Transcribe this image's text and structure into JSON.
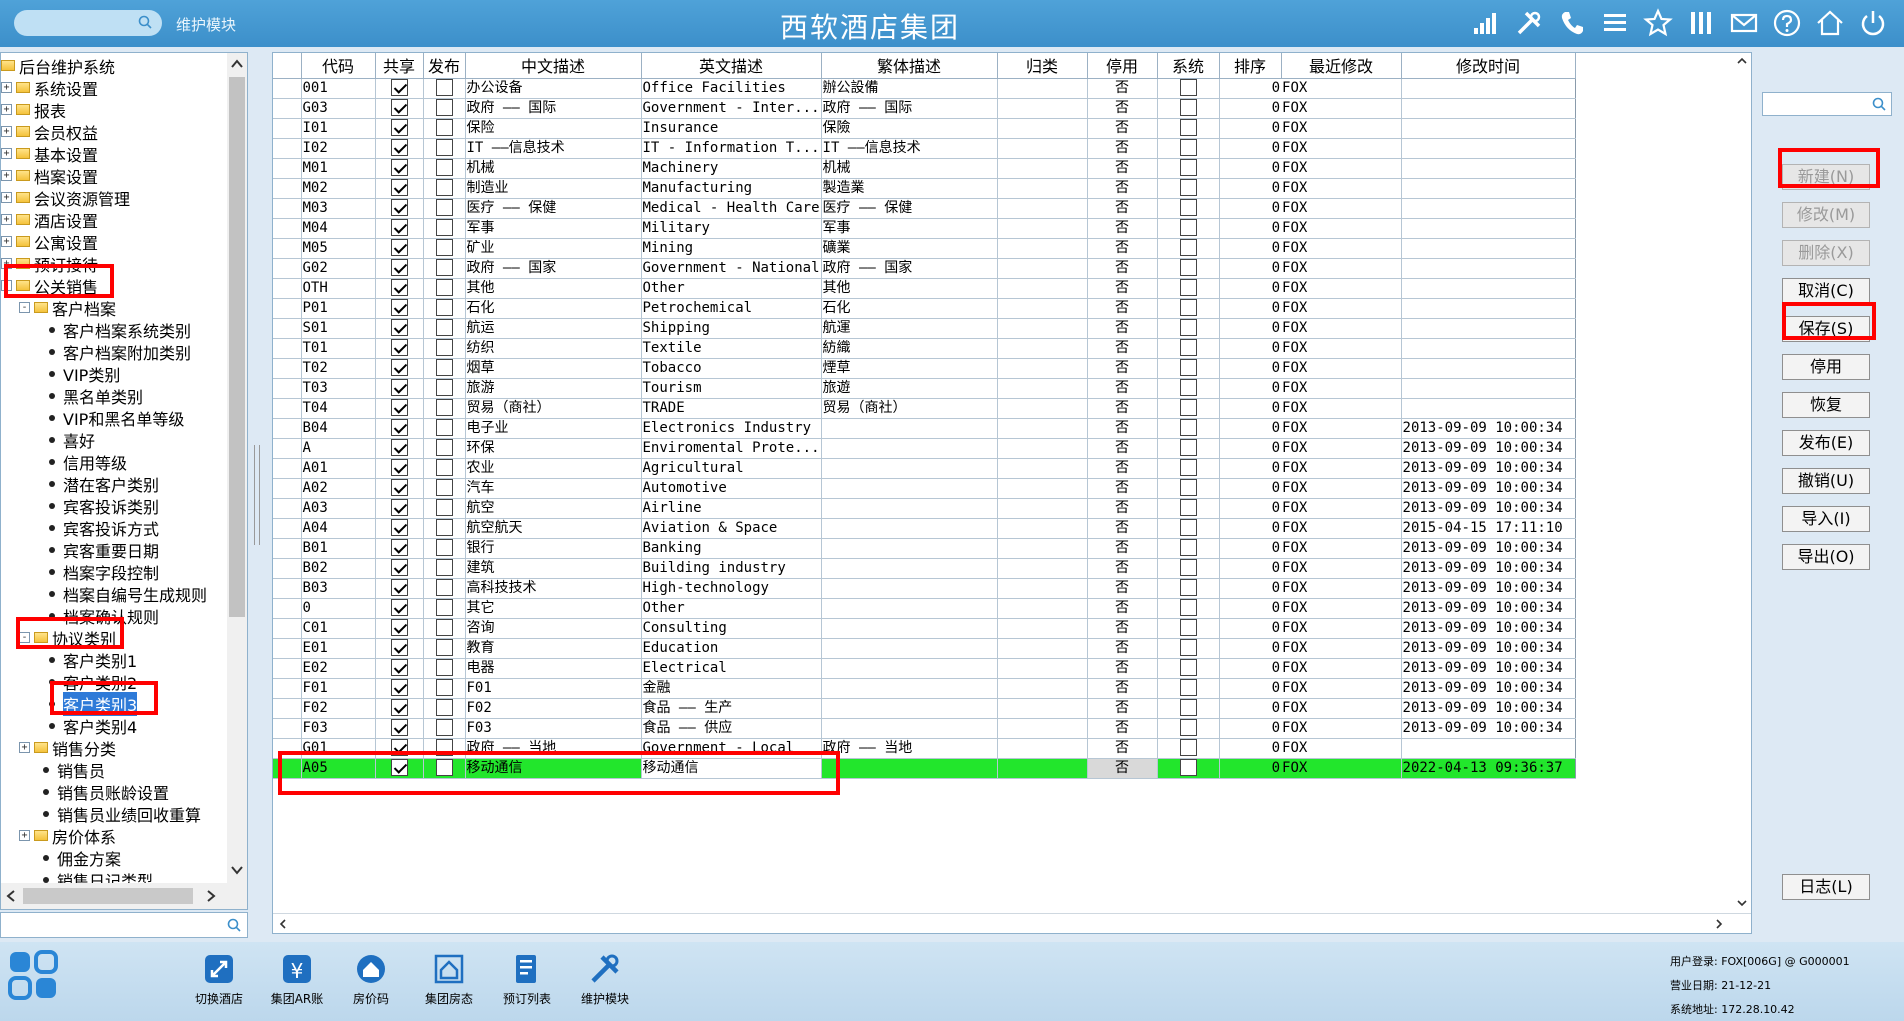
{
  "header": {
    "module_label": "维护模块",
    "title": "西软酒店集团"
  },
  "tree": [
    {
      "label": "后台维护系统",
      "kind": "root",
      "level": 0
    },
    {
      "label": "系统设置",
      "kind": "folder",
      "level": 0
    },
    {
      "label": "报表",
      "kind": "folder",
      "level": 0
    },
    {
      "label": "会员权益",
      "kind": "folder",
      "level": 0
    },
    {
      "label": "基本设置",
      "kind": "folder",
      "level": 0
    },
    {
      "label": "档案设置",
      "kind": "folder",
      "level": 0
    },
    {
      "label": "会议资源管理",
      "kind": "folder",
      "level": 0
    },
    {
      "label": "酒店设置",
      "kind": "folder",
      "level": 0
    },
    {
      "label": "公寓设置",
      "kind": "folder",
      "level": 0
    },
    {
      "label": "预订接待",
      "kind": "folder",
      "level": 0
    },
    {
      "label": "公关销售",
      "kind": "folder-open",
      "level": 0
    },
    {
      "label": "客户档案",
      "kind": "folder-open",
      "level": 1
    },
    {
      "label": "客户档案系统类别",
      "kind": "leaf",
      "level": 2
    },
    {
      "label": "客户档案附加类别",
      "kind": "leaf",
      "level": 2
    },
    {
      "label": "VIP类别",
      "kind": "leaf",
      "level": 2
    },
    {
      "label": "黑名单类别",
      "kind": "leaf",
      "level": 2
    },
    {
      "label": "VIP和黑名单等级",
      "kind": "leaf",
      "level": 2
    },
    {
      "label": "喜好",
      "kind": "leaf",
      "level": 2
    },
    {
      "label": "信用等级",
      "kind": "leaf",
      "level": 2
    },
    {
      "label": "潜在客户类别",
      "kind": "leaf",
      "level": 2
    },
    {
      "label": "宾客投诉类别",
      "kind": "leaf",
      "level": 2
    },
    {
      "label": "宾客投诉方式",
      "kind": "leaf",
      "level": 2
    },
    {
      "label": "宾客重要日期",
      "kind": "leaf",
      "level": 2
    },
    {
      "label": "档案字段控制",
      "kind": "leaf",
      "level": 2
    },
    {
      "label": "档案自编号生成规则",
      "kind": "leaf",
      "level": 2
    },
    {
      "label": "档案确认规则",
      "kind": "leaf",
      "level": 2
    },
    {
      "label": "协议类别",
      "kind": "folder-open",
      "level": 1
    },
    {
      "label": "客户类别1",
      "kind": "leaf",
      "level": 2
    },
    {
      "label": "客户类别2",
      "kind": "leaf",
      "level": 2
    },
    {
      "label": "客户类别3",
      "kind": "leaf",
      "level": 2,
      "selected": true
    },
    {
      "label": "客户类别4",
      "kind": "leaf",
      "level": 2
    },
    {
      "label": "销售分类",
      "kind": "folder",
      "level": 1
    },
    {
      "label": "销售员",
      "kind": "leaf",
      "level": 1
    },
    {
      "label": "销售员账龄设置",
      "kind": "leaf",
      "level": 1
    },
    {
      "label": "销售员业绩回收重算",
      "kind": "leaf",
      "level": 1
    },
    {
      "label": "房价体系",
      "kind": "folder",
      "level": 1
    },
    {
      "label": "佣金方案",
      "kind": "leaf",
      "level": 1
    },
    {
      "label": "销售日记类型",
      "kind": "leaf",
      "level": 1
    }
  ],
  "grid": {
    "columns": [
      "代码",
      "共享",
      "发布",
      "中文描述",
      "英文描述",
      "繁体描述",
      "归类",
      "停用",
      "系统",
      "排序",
      "最近修改",
      "修改时间"
    ],
    "rows": [
      {
        "code": "001",
        "share": true,
        "pub": false,
        "cn": "办公设备",
        "en": "Office Facilities",
        "tw": "辦公設備",
        "cat": "",
        "stop": "否",
        "sys": false,
        "sort": "0",
        "mod": "FOX",
        "time": ""
      },
      {
        "code": "G03",
        "share": true,
        "pub": false,
        "cn": "政府 —— 国际",
        "en": "Government - Inter...",
        "tw": "政府 —— 国际",
        "cat": "",
        "stop": "否",
        "sys": false,
        "sort": "0",
        "mod": "FOX",
        "time": ""
      },
      {
        "code": "I01",
        "share": true,
        "pub": false,
        "cn": "保险",
        "en": "Insurance",
        "tw": "保險",
        "cat": "",
        "stop": "否",
        "sys": false,
        "sort": "0",
        "mod": "FOX",
        "time": ""
      },
      {
        "code": "I02",
        "share": true,
        "pub": false,
        "cn": "IT ——信息技术",
        "en": "IT - Information T...",
        "tw": "IT ——信息技术",
        "cat": "",
        "stop": "否",
        "sys": false,
        "sort": "0",
        "mod": "FOX",
        "time": ""
      },
      {
        "code": "M01",
        "share": true,
        "pub": false,
        "cn": "机械",
        "en": "Machinery",
        "tw": "机械",
        "cat": "",
        "stop": "否",
        "sys": false,
        "sort": "0",
        "mod": "FOX",
        "time": ""
      },
      {
        "code": "M02",
        "share": true,
        "pub": false,
        "cn": "制造业",
        "en": "Manufacturing",
        "tw": "製造業",
        "cat": "",
        "stop": "否",
        "sys": false,
        "sort": "0",
        "mod": "FOX",
        "time": ""
      },
      {
        "code": "M03",
        "share": true,
        "pub": false,
        "cn": "医疗 —— 保健",
        "en": "Medical - Health Care",
        "tw": "医疗 —— 保健",
        "cat": "",
        "stop": "否",
        "sys": false,
        "sort": "0",
        "mod": "FOX",
        "time": ""
      },
      {
        "code": "M04",
        "share": true,
        "pub": false,
        "cn": "军事",
        "en": "Military",
        "tw": "军事",
        "cat": "",
        "stop": "否",
        "sys": false,
        "sort": "0",
        "mod": "FOX",
        "time": ""
      },
      {
        "code": "M05",
        "share": true,
        "pub": false,
        "cn": "矿业",
        "en": "Mining",
        "tw": "礦業",
        "cat": "",
        "stop": "否",
        "sys": false,
        "sort": "0",
        "mod": "FOX",
        "time": ""
      },
      {
        "code": "G02",
        "share": true,
        "pub": false,
        "cn": "政府 —— 国家",
        "en": "Government - National",
        "tw": "政府 —— 国家",
        "cat": "",
        "stop": "否",
        "sys": false,
        "sort": "0",
        "mod": "FOX",
        "time": ""
      },
      {
        "code": "OTH",
        "share": true,
        "pub": false,
        "cn": "其他",
        "en": "Other",
        "tw": "其他",
        "cat": "",
        "stop": "否",
        "sys": false,
        "sort": "0",
        "mod": "FOX",
        "time": ""
      },
      {
        "code": "P01",
        "share": true,
        "pub": false,
        "cn": "石化",
        "en": "Petrochemical",
        "tw": "石化",
        "cat": "",
        "stop": "否",
        "sys": false,
        "sort": "0",
        "mod": "FOX",
        "time": ""
      },
      {
        "code": "S01",
        "share": true,
        "pub": false,
        "cn": "航运",
        "en": "Shipping",
        "tw": "航運",
        "cat": "",
        "stop": "否",
        "sys": false,
        "sort": "0",
        "mod": "FOX",
        "time": ""
      },
      {
        "code": "T01",
        "share": true,
        "pub": false,
        "cn": "纺织",
        "en": "Textile",
        "tw": "紡織",
        "cat": "",
        "stop": "否",
        "sys": false,
        "sort": "0",
        "mod": "FOX",
        "time": ""
      },
      {
        "code": "T02",
        "share": true,
        "pub": false,
        "cn": "烟草",
        "en": "Tobacco",
        "tw": "煙草",
        "cat": "",
        "stop": "否",
        "sys": false,
        "sort": "0",
        "mod": "FOX",
        "time": ""
      },
      {
        "code": "T03",
        "share": true,
        "pub": false,
        "cn": "旅游",
        "en": "Tourism",
        "tw": "旅遊",
        "cat": "",
        "stop": "否",
        "sys": false,
        "sort": "0",
        "mod": "FOX",
        "time": ""
      },
      {
        "code": "T04",
        "share": true,
        "pub": false,
        "cn": "贸易（商社）",
        "en": "TRADE",
        "tw": "贸易（商社）",
        "cat": "",
        "stop": "否",
        "sys": false,
        "sort": "0",
        "mod": "FOX",
        "time": ""
      },
      {
        "code": "B04",
        "share": true,
        "pub": false,
        "cn": "电子业",
        "en": "Electronics Industry",
        "tw": "",
        "cat": "",
        "stop": "否",
        "sys": false,
        "sort": "0",
        "mod": "FOX",
        "time": "2013-09-09 10:00:34"
      },
      {
        "code": "A",
        "share": true,
        "pub": false,
        "cn": "环保",
        "en": "Enviromental Prote...",
        "tw": "",
        "cat": "",
        "stop": "否",
        "sys": false,
        "sort": "0",
        "mod": "FOX",
        "time": "2013-09-09 10:00:34"
      },
      {
        "code": "A01",
        "share": true,
        "pub": false,
        "cn": "农业",
        "en": "Agricultural",
        "tw": "",
        "cat": "",
        "stop": "否",
        "sys": false,
        "sort": "0",
        "mod": "FOX",
        "time": "2013-09-09 10:00:34"
      },
      {
        "code": "A02",
        "share": true,
        "pub": false,
        "cn": "汽车",
        "en": "Automotive",
        "tw": "",
        "cat": "",
        "stop": "否",
        "sys": false,
        "sort": "0",
        "mod": "FOX",
        "time": "2013-09-09 10:00:34"
      },
      {
        "code": "A03",
        "share": true,
        "pub": false,
        "cn": "航空",
        "en": "Airline",
        "tw": "",
        "cat": "",
        "stop": "否",
        "sys": false,
        "sort": "0",
        "mod": "FOX",
        "time": "2013-09-09 10:00:34"
      },
      {
        "code": "A04",
        "share": true,
        "pub": false,
        "cn": "航空航天",
        "en": "Aviation & Space",
        "tw": "",
        "cat": "",
        "stop": "否",
        "sys": false,
        "sort": "0",
        "mod": "FOX",
        "time": "2015-04-15 17:11:10"
      },
      {
        "code": "B01",
        "share": true,
        "pub": false,
        "cn": "银行",
        "en": "Banking",
        "tw": "",
        "cat": "",
        "stop": "否",
        "sys": false,
        "sort": "0",
        "mod": "FOX",
        "time": "2013-09-09 10:00:34"
      },
      {
        "code": "B02",
        "share": true,
        "pub": false,
        "cn": "建筑",
        "en": "Building industry",
        "tw": "",
        "cat": "",
        "stop": "否",
        "sys": false,
        "sort": "0",
        "mod": "FOX",
        "time": "2013-09-09 10:00:34"
      },
      {
        "code": "B03",
        "share": true,
        "pub": false,
        "cn": "高科技技术",
        "en": "High-technology",
        "tw": "",
        "cat": "",
        "stop": "否",
        "sys": false,
        "sort": "0",
        "mod": "FOX",
        "time": "2013-09-09 10:00:34"
      },
      {
        "code": "0",
        "share": true,
        "pub": false,
        "cn": "其它",
        "en": "Other",
        "tw": "",
        "cat": "",
        "stop": "否",
        "sys": false,
        "sort": "0",
        "mod": "FOX",
        "time": "2013-09-09 10:00:34"
      },
      {
        "code": "C01",
        "share": true,
        "pub": false,
        "cn": "咨询",
        "en": "Consulting",
        "tw": "",
        "cat": "",
        "stop": "否",
        "sys": false,
        "sort": "0",
        "mod": "FOX",
        "time": "2013-09-09 10:00:34"
      },
      {
        "code": "E01",
        "share": true,
        "pub": false,
        "cn": "教育",
        "en": "Education",
        "tw": "",
        "cat": "",
        "stop": "否",
        "sys": false,
        "sort": "0",
        "mod": "FOX",
        "time": "2013-09-09 10:00:34"
      },
      {
        "code": "E02",
        "share": true,
        "pub": false,
        "cn": "电器",
        "en": "Electrical",
        "tw": "",
        "cat": "",
        "stop": "否",
        "sys": false,
        "sort": "0",
        "mod": "FOX",
        "time": "2013-09-09 10:00:34"
      },
      {
        "code": "F01",
        "share": true,
        "pub": false,
        "cn": "F01",
        "en": "金融",
        "tw": "",
        "cat": "",
        "stop": "否",
        "sys": false,
        "sort": "0",
        "mod": "FOX",
        "time": "2013-09-09 10:00:34"
      },
      {
        "code": "F02",
        "share": true,
        "pub": false,
        "cn": "F02",
        "en": "食品 —— 生产",
        "tw": "",
        "cat": "",
        "stop": "否",
        "sys": false,
        "sort": "0",
        "mod": "FOX",
        "time": "2013-09-09 10:00:34"
      },
      {
        "code": "F03",
        "share": true,
        "pub": false,
        "cn": "F03",
        "en": "食品 —— 供应",
        "tw": "",
        "cat": "",
        "stop": "否",
        "sys": false,
        "sort": "0",
        "mod": "FOX",
        "time": "2013-09-09 10:00:34"
      },
      {
        "code": "G01",
        "share": true,
        "pub": false,
        "cn": "政府 —— 当地",
        "en": "Government - Local",
        "tw": "政府 —— 当地",
        "cat": "",
        "stop": "否",
        "sys": false,
        "sort": "0",
        "mod": "FOX",
        "time": ""
      },
      {
        "code": "A05",
        "share": true,
        "pub": false,
        "cn": "移动通信",
        "en": "移动通信",
        "tw": "",
        "cat": "",
        "stop": "否",
        "sys": false,
        "sort": "0",
        "mod": "FOX",
        "time": "2022-04-13 09:36:37",
        "highlight": true
      }
    ]
  },
  "buttons": [
    {
      "label": "新建(N)",
      "enabled": false
    },
    {
      "label": "修改(M)",
      "enabled": false
    },
    {
      "label": "删除(X)",
      "enabled": false
    },
    {
      "label": "取消(C)",
      "enabled": true
    },
    {
      "label": "保存(S)",
      "enabled": true
    },
    {
      "label": "停用",
      "enabled": true
    },
    {
      "label": "恢复",
      "enabled": true
    },
    {
      "label": "发布(E)",
      "enabled": true
    },
    {
      "label": "撤销(U)",
      "enabled": true
    },
    {
      "label": "导入(I)",
      "enabled": true
    },
    {
      "label": "导出(O)",
      "enabled": true
    }
  ],
  "log_button": "日志(L)",
  "taskbar": [
    {
      "label": "切换酒店",
      "icon": "switch-hotel-icon"
    },
    {
      "label": "集团AR账",
      "icon": "ar-account-icon"
    },
    {
      "label": "房价码",
      "icon": "rate-code-icon"
    },
    {
      "label": "集团房态",
      "icon": "room-status-icon"
    },
    {
      "label": "预订列表",
      "icon": "reservation-list-icon"
    },
    {
      "label": "维护模块",
      "icon": "maintenance-icon"
    }
  ],
  "status": {
    "user": "用户登录: FOX[006G] @ G000001",
    "biz_date": "营业日期: 21-12-21",
    "address": "系统地址: 172.28.10.42"
  },
  "colors": {
    "accent": "#3c8fca",
    "highlight_row": "#22e62c",
    "annotation": "#ff0000"
  }
}
